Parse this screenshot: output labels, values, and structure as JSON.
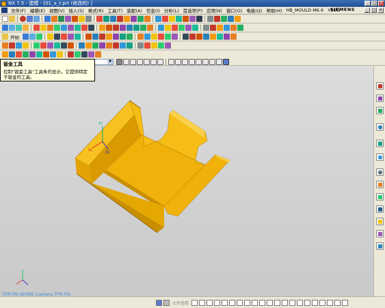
{
  "window": {
    "title": "NX 7.5 - 建模 - [01_a_t.prt (修改的) ]"
  },
  "menubar": {
    "items": [
      "文件(F)",
      "编辑(E)",
      "视图(V)",
      "插入(S)",
      "格式(R)",
      "工具(T)",
      "装配(A)",
      "信息(I)",
      "分析(L)",
      "首选项(P)",
      "应用(N)",
      "窗口(O)",
      "电极(Q)",
      "帮助(H)",
      "HB_MOULD M6.6",
      "YSUG"
    ],
    "brand": "SIEMENS"
  },
  "toolbar": {
    "start_label": "开始·"
  },
  "tooltip": {
    "title": "钣金工具",
    "text_line1": "控制\"钣金工具\"工具条的显示，它提供特定",
    "text_line2": "于钣金的工具。"
  },
  "viewport": {
    "view_label": "TFR-TRI WORK Camera TFR-TRI",
    "part_color": "#f0b20a",
    "triad_labels": {
      "x": "XC",
      "y": "YC",
      "z": "ZC"
    }
  },
  "statusbar": {
    "filter_text": "元件选取"
  },
  "icons": [
    "new-icon",
    "open-icon",
    "save-icon",
    "cut-icon",
    "copy-icon",
    "undo-icon",
    "sketch-icon",
    "extrude-icon",
    "hole-icon",
    "blend-icon",
    "chamfer-icon",
    "view-icon",
    "render-icon",
    "sheetmetal-icon",
    "snap-icon"
  ]
}
